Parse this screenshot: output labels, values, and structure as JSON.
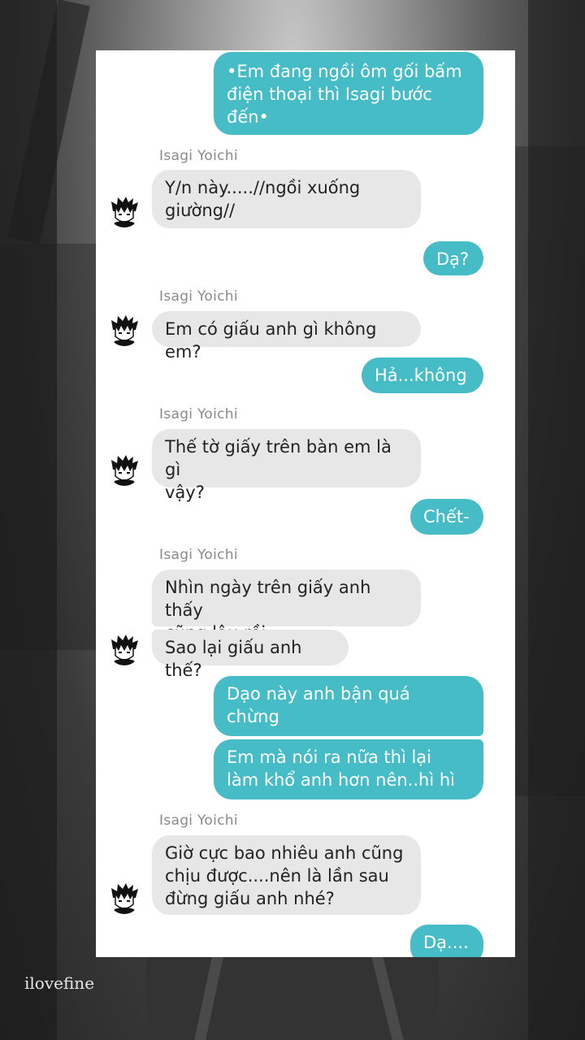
{
  "sender_name": "Isagi Yoichi",
  "colors": {
    "outgoing_bubble": "#46bcc6",
    "incoming_bubble": "#e7e7e7",
    "panel": "#ffffff"
  },
  "messages": [
    {
      "from": "me",
      "text": "•Em đang ngồi ôm gối bấm\nđiện thoại thì Isagi bước\nđến•"
    },
    {
      "from": "Isagi Yoichi",
      "text": "Y/n này.....//ngồi xuống\ngiường//"
    },
    {
      "from": "me",
      "text": "Dạ?"
    },
    {
      "from": "Isagi Yoichi",
      "text": "Em có giấu anh gì không em?"
    },
    {
      "from": "me",
      "text": "Hả...không"
    },
    {
      "from": "Isagi Yoichi",
      "text": "Thế tờ giấy trên bàn em là gì\nvậy?"
    },
    {
      "from": "me",
      "text": "Chết-"
    },
    {
      "from": "Isagi Yoichi",
      "text": "Nhìn ngày trên giấy anh thấy\ncũng lâu rồi"
    },
    {
      "from": "Isagi Yoichi",
      "text": "Sao lại giấu anh thế?"
    },
    {
      "from": "me",
      "text": "Dạo này anh bận quá\nchừng"
    },
    {
      "from": "me",
      "text": "Em mà nói ra nữa thì lại\nlàm khổ anh hơn nên..hì hì"
    },
    {
      "from": "Isagi Yoichi",
      "text": "Giờ cực bao nhiêu anh cũng\nchịu được....nên là lần sau\nđừng giấu anh nhé?"
    },
    {
      "from": "me",
      "text": "Dạ...."
    }
  ],
  "avatar_icon": "anime-boy-avatar-icon",
  "watermark": "ilovefine"
}
